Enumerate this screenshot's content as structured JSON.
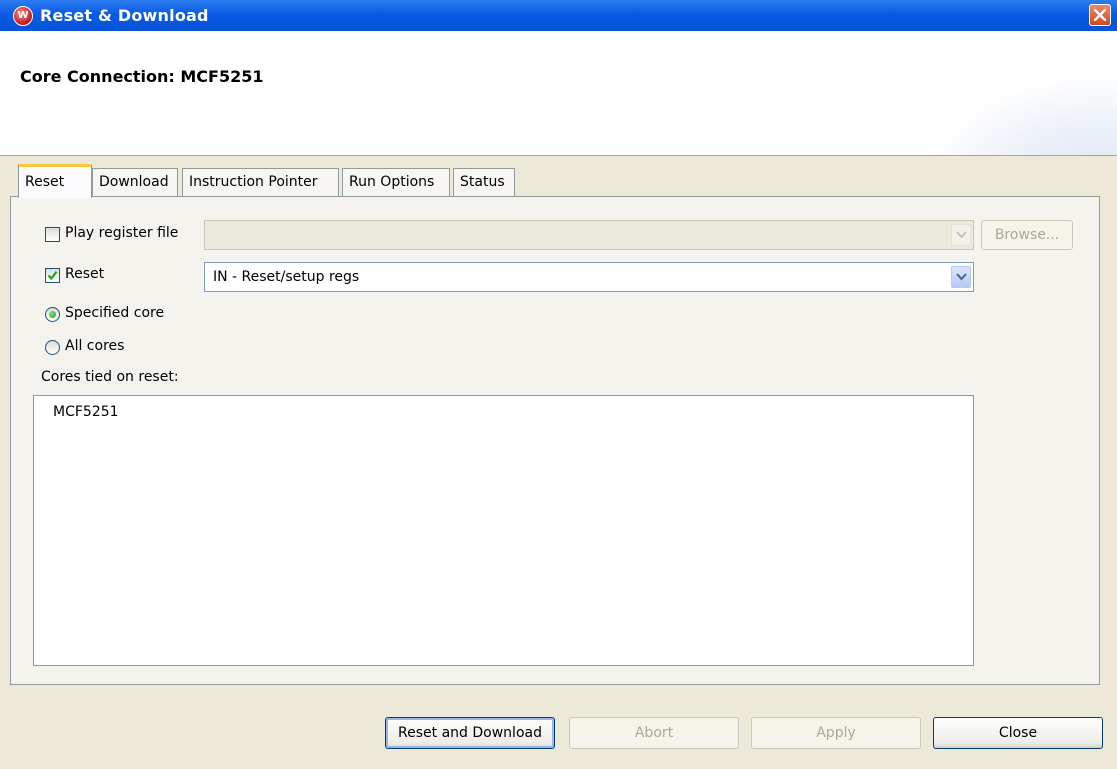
{
  "window": {
    "title": "Reset & Download",
    "app_icon": "wind-river-logo-icon",
    "close_icon": "close-icon"
  },
  "header": {
    "title": "Core Connection: MCF5251"
  },
  "tabs": [
    {
      "label": "Reset",
      "active": true
    },
    {
      "label": "Download",
      "active": false
    },
    {
      "label": "Instruction Pointer",
      "active": false
    },
    {
      "label": "Run Options",
      "active": false
    },
    {
      "label": "Status",
      "active": false
    }
  ],
  "reset_tab": {
    "play_register_file": {
      "label": "Play register file",
      "checked": false,
      "value": ""
    },
    "browse_label": "Browse...",
    "reset": {
      "label": "Reset",
      "checked": true,
      "selected_value": "IN - Reset/setup regs"
    },
    "specified_core": {
      "label": "Specified core",
      "selected": true
    },
    "all_cores": {
      "label": "All cores",
      "selected": false
    },
    "cores_tied_label": "Cores tied on reset:",
    "cores": [
      "MCF5251"
    ]
  },
  "buttons": {
    "reset_and_download": "Reset and Download",
    "abort": "Abort",
    "apply": "Apply",
    "close": "Close"
  },
  "colors": {
    "titlebar": "#0a5ae6",
    "active_tab_accent": "#ffc83c",
    "dialog_bg": "#ece9d8"
  }
}
